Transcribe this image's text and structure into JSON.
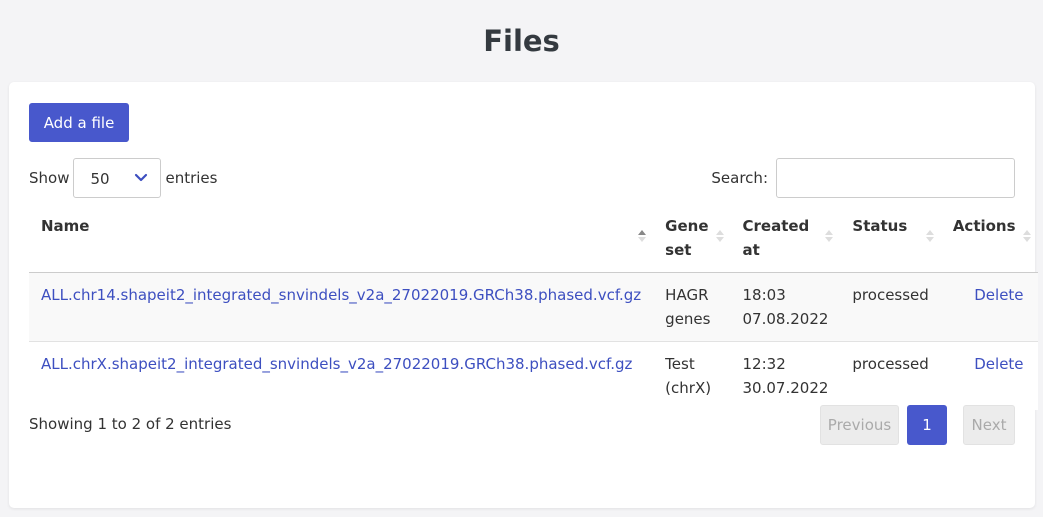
{
  "page": {
    "title": "Files"
  },
  "toolbar": {
    "add_label": "Add a file"
  },
  "length": {
    "show_label": "Show",
    "value": "50",
    "entries_label": "entries"
  },
  "search": {
    "label": "Search:",
    "value": ""
  },
  "table": {
    "headers": [
      "Name",
      "Gene set",
      "Created at",
      "Status",
      "Actions"
    ],
    "rows": [
      {
        "name": "ALL.chr14.shapeit2_integrated_snvindels_v2a_27022019.GRCh38.phased.vcf.gz",
        "gene_set": "HAGR genes",
        "created_time": "18:03",
        "created_date": "07.08.2022",
        "status": "processed",
        "action": "Delete"
      },
      {
        "name": "ALL.chrX.shapeit2_integrated_snvindels_v2a_27022019.GRCh38.phased.vcf.gz",
        "gene_set": "Test (chrX)",
        "created_time": "12:32",
        "created_date": "30.07.2022",
        "status": "processed",
        "action": "Delete"
      }
    ]
  },
  "footer": {
    "info": "Showing 1 to 2 of 2 entries"
  },
  "pagination": {
    "previous": "Previous",
    "current": "1",
    "next": "Next"
  },
  "colors": {
    "primary": "#4858cc",
    "link": "#3d4fc0",
    "background": "#f4f4f6"
  },
  "icons": {
    "sort": "sort-arrows-icon",
    "dropdown": "chevron-down-icon"
  }
}
